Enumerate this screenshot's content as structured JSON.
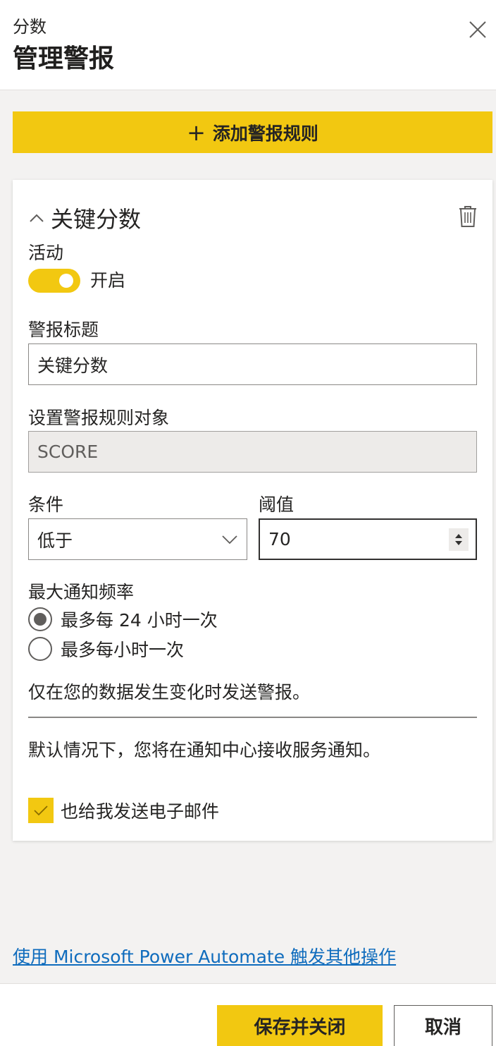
{
  "header": {
    "subtitle": "分数",
    "title": "管理警报",
    "close_icon": "close-icon"
  },
  "add_rule": {
    "icon": "plus-icon",
    "label": "添加警报规则"
  },
  "alert_rule": {
    "title": "关键分数",
    "collapse_icon": "chevron-up-icon",
    "delete_icon": "trash-icon",
    "active": {
      "label": "活动",
      "state_label": "开启",
      "on": true
    },
    "alert_title": {
      "label": "警报标题",
      "value": "关键分数"
    },
    "target": {
      "label": "设置警报规则对象",
      "value": "SCORE"
    },
    "condition": {
      "label": "条件",
      "value": "低于"
    },
    "threshold": {
      "label": "阈值",
      "value": "70"
    },
    "frequency": {
      "label": "最大通知频率",
      "options": [
        {
          "label": "最多每 24 小时一次",
          "selected": true
        },
        {
          "label": "最多每小时一次",
          "selected": false
        }
      ]
    },
    "data_change_note": "仅在您的数据发生变化时发送警报。",
    "notification_note": "默认情况下，您将在通知中心接收服务通知。",
    "email": {
      "label": "也给我发送电子邮件",
      "checked": true
    }
  },
  "power_automate_link": "使用 Microsoft Power Automate 触发其他操作",
  "footer": {
    "save_label": "保存并关闭",
    "cancel_label": "取消"
  },
  "colors": {
    "accent": "#f2c811",
    "link": "#0f6cbd",
    "text": "#252423"
  }
}
